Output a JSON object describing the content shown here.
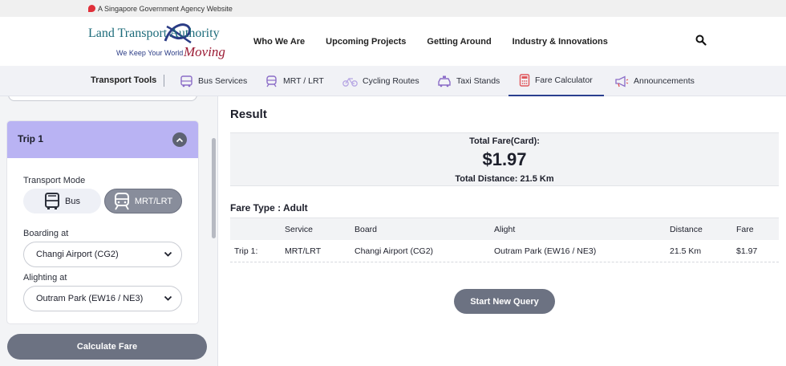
{
  "gov_banner": {
    "text": "A Singapore Government Agency Website"
  },
  "logo": {
    "org_name": "Land Transport Authority",
    "tagline": "We Keep Your World",
    "tagline_script": "Moving"
  },
  "nav": {
    "items": [
      {
        "label": "Who We Are"
      },
      {
        "label": "Upcoming Projects"
      },
      {
        "label": "Getting Around"
      },
      {
        "label": "Industry & Innovations"
      }
    ],
    "search_icon": "search-icon"
  },
  "tools_bar": {
    "title": "Transport Tools",
    "items": [
      {
        "label": "Bus Services",
        "icon": "bus-icon"
      },
      {
        "label": "MRT / LRT",
        "icon": "train-icon"
      },
      {
        "label": "Cycling Routes",
        "icon": "bicycle-icon"
      },
      {
        "label": "Taxi Stands",
        "icon": "taxi-icon"
      },
      {
        "label": "Fare Calculator",
        "icon": "calculator-icon",
        "active": true
      },
      {
        "label": "Announcements",
        "icon": "megaphone-icon"
      }
    ],
    "accent_color": "#2a3f8f"
  },
  "trip": {
    "title": "Trip 1",
    "transport_mode_label": "Transport Mode",
    "modes": [
      {
        "label": "Bus",
        "selected": false
      },
      {
        "label": "MRT/LRT",
        "selected": true
      }
    ],
    "boarding_label": "Boarding at",
    "boarding_value": "Changi Airport (CG2)",
    "alighting_label": "Alighting at",
    "alighting_value": "Outram Park (EW16 / NE3)",
    "header_color": "#b9b3f3"
  },
  "calculate_button": "Calculate Fare",
  "result": {
    "title": "Result",
    "total_fare_label": "Total Fare(Card):",
    "total_fare_value": "$1.97",
    "total_distance": "Total Distance: 21.5 Km",
    "fare_type": "Fare Type : Adult",
    "table": {
      "headers": [
        "",
        "Service",
        "Board",
        "Alight",
        "Distance",
        "Fare"
      ],
      "rows": [
        [
          "Trip 1:",
          "MRT/LRT",
          "Changi Airport (CG2)",
          "Outram Park (EW16 / NE3)",
          "21.5 Km",
          "$1.97"
        ]
      ]
    },
    "new_query_button": "Start New Query"
  }
}
